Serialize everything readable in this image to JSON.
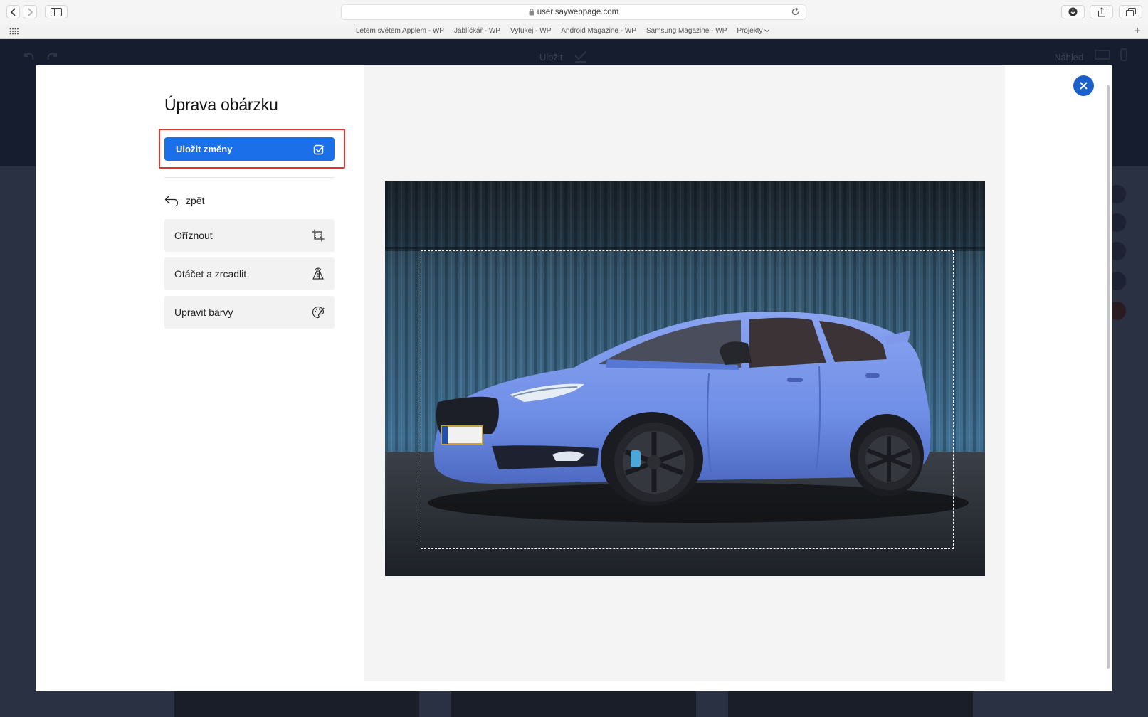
{
  "browser": {
    "url": "user.saywebpage.com",
    "bookmarks": [
      {
        "label": "Letem světem Applem - WP"
      },
      {
        "label": "Jablíčkář - WP"
      },
      {
        "label": "Vyfukej - WP"
      },
      {
        "label": "Android Magazine - WP"
      },
      {
        "label": "Samsung Magazine - WP"
      },
      {
        "label": "Projekty"
      }
    ]
  },
  "app": {
    "save_label": "Uložit",
    "preview_label": "Náhled"
  },
  "editor": {
    "title": "Úprava obárzku",
    "save_changes_label": "Uložit změny",
    "back_label": "zpět",
    "tools": [
      {
        "label": "Oříznout",
        "icon": "crop-icon"
      },
      {
        "label": "Otáčet a zrcadlit",
        "icon": "flip-icon"
      },
      {
        "label": "Upravit barvy",
        "icon": "palette-icon"
      }
    ]
  },
  "colors": {
    "primary": "#1b6fe8",
    "highlight": "#e0362a",
    "close": "#1b5fc9",
    "car": "#6f8ee6",
    "container": "#3f6f92"
  }
}
